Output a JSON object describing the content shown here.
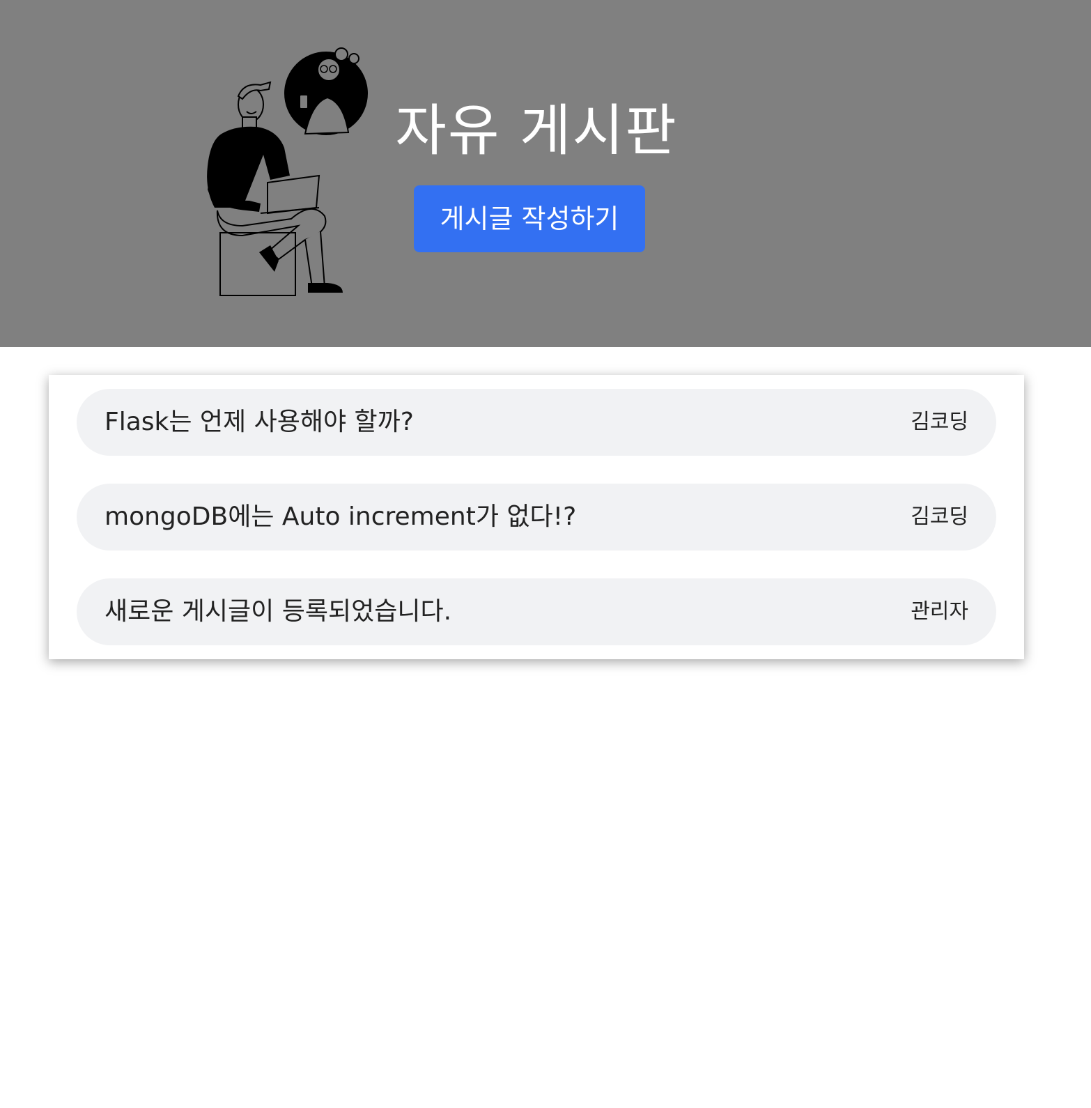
{
  "header": {
    "title": "자유 게시판",
    "write_button_label": "게시글 작성하기",
    "illustration_icon": "person-with-laptop-illustration"
  },
  "posts": [
    {
      "title": "Flask는 언제 사용해야 할까?",
      "author": "김코딩"
    },
    {
      "title": "mongoDB에는 Auto increment가 없다!?",
      "author": "김코딩"
    },
    {
      "title": "새로운 게시글이 등록되었습니다.",
      "author": "관리자"
    }
  ],
  "colors": {
    "hero_background": "#808080",
    "button": "#3370f2",
    "post_background": "#f1f2f4"
  }
}
